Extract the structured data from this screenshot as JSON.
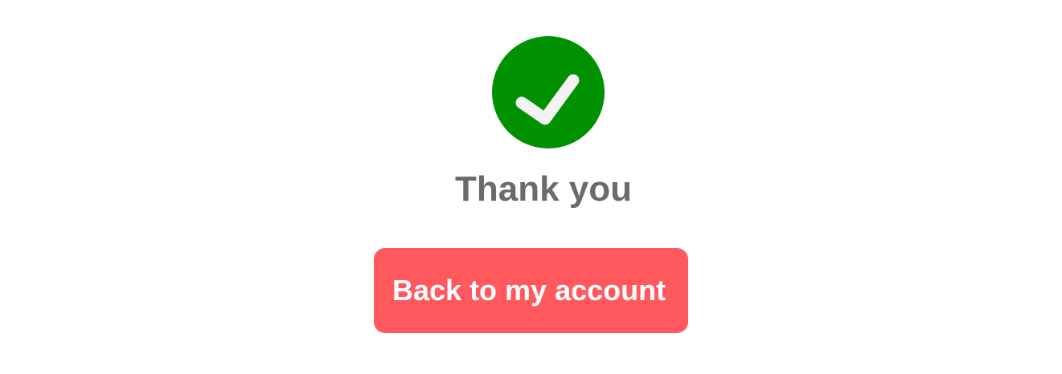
{
  "confirmation": {
    "icon": "check-circle-icon",
    "icon_color": "#009100",
    "title": "Thank you"
  },
  "actions": {
    "back_label": "Back to my account",
    "back_color": "#ff585d"
  }
}
